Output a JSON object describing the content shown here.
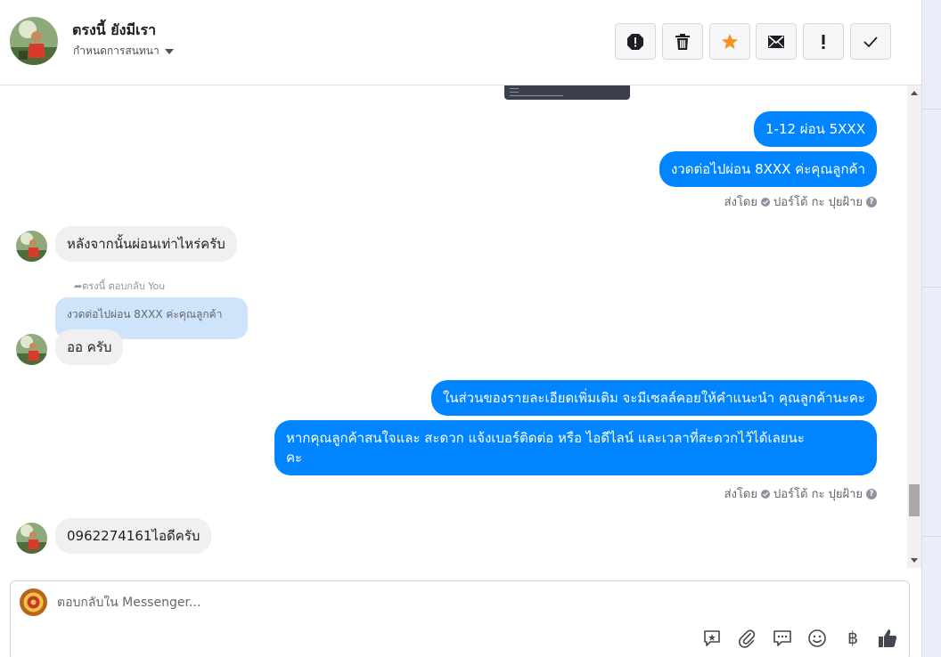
{
  "header": {
    "contact_name": "ตรงนี้ ยังมีเรา",
    "settings_label": "กำหนดการสนทนา",
    "toolbar_icons": [
      "spam-icon",
      "trash-icon",
      "star-icon",
      "envelope-icon",
      "exclamation-icon",
      "check-icon"
    ]
  },
  "colors": {
    "accent": "#0084ff",
    "star": "#f7931e",
    "incoming_bubble": "#f0f0f0",
    "quote_bubble": "#cfe3fb"
  },
  "thread": {
    "messages": [
      {
        "side": "out",
        "text": "1-12 ผ่อน 5XXX"
      },
      {
        "side": "out",
        "text": "งวดต่อไปผ่อน 8XXX ค่ะคุณลูกค้า"
      },
      {
        "side": "in",
        "text": "หลังจากนั้นผ่อนเท่าไหร่ครับ"
      },
      {
        "side": "in",
        "text": "ออ ครับ"
      },
      {
        "side": "out",
        "text": "ในส่วนของรายละเอียดเพิ่มเติม จะมีเซลล์คอยให้คำแนะนำ คุณลูกค้านะคะ"
      },
      {
        "side": "out",
        "text": "หากคุณลูกค้าสนใจและ สะดวก แจ้งเบอร์ติดต่อ หรือ ไอดีไลน์ และเวลาที่สะดวกไว้ได้เลยนะ",
        "text_line2": "คะ"
      },
      {
        "side": "in",
        "text": "0962274161ไอดีครับ"
      }
    ],
    "sent_by": "ส่งโดย",
    "sender": "ปอร์โต้ กะ ปุยฝ้าย",
    "reply_label": "ตรงนี้ ตอบกลับ You",
    "reply_quote": "งวดต่อไปผ่อน 8XXX ค่ะคุณลูกค้า"
  },
  "composer": {
    "placeholder": "ตอบกลับใน Messenger...",
    "icons": [
      "saved-reply-icon",
      "attachment-icon",
      "chat-bubbles-icon",
      "emoji-icon",
      "baht-icon",
      "thumbs-up-icon"
    ],
    "baht_symbol": "฿"
  }
}
